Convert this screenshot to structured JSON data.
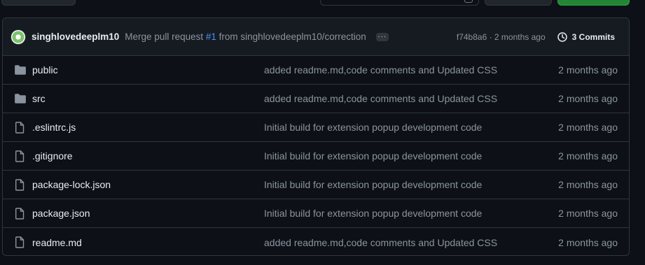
{
  "commit": {
    "author": "singhlovedeeplm10",
    "message_prefix": "Merge pull request ",
    "pr_number": "#1",
    "message_suffix": " from singhlovedeeplm10/correction",
    "sha_age": "f74b8a6 · 2 months ago",
    "commits_label": "3 Commits"
  },
  "files": [
    {
      "name": "public",
      "type": "folder",
      "message": "added readme.md,code comments and Updated CSS",
      "age": "2 months ago"
    },
    {
      "name": "src",
      "type": "folder",
      "message": "added readme.md,code comments and Updated CSS",
      "age": "2 months ago"
    },
    {
      "name": ".eslintrc.js",
      "type": "file",
      "message": "Initial build for extension popup development code",
      "age": "2 months ago"
    },
    {
      "name": ".gitignore",
      "type": "file",
      "message": "Initial build for extension popup development code",
      "age": "2 months ago"
    },
    {
      "name": "package-lock.json",
      "type": "file",
      "message": "Initial build for extension popup development code",
      "age": "2 months ago"
    },
    {
      "name": "package.json",
      "type": "file",
      "message": "Initial build for extension popup development code",
      "age": "2 months ago"
    },
    {
      "name": "readme.md",
      "type": "file",
      "message": "added readme.md,code comments and Updated CSS",
      "age": "2 months ago"
    }
  ],
  "colors": {
    "accent_link": "#4493f8",
    "code_button": "#238636",
    "icon": "#8b949e"
  }
}
